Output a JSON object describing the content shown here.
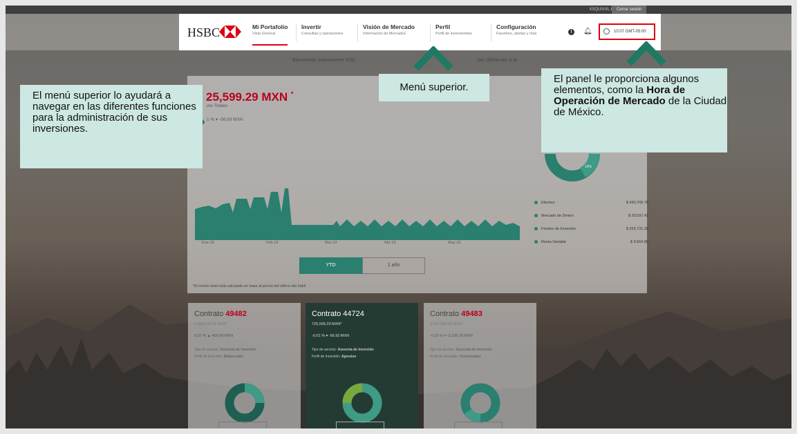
{
  "topbar": {
    "user_info": "XSQUIVXL HILTCN COSTRC",
    "logout": "Cerrar sesión"
  },
  "header": {
    "logo": "HSBC",
    "nav": [
      {
        "title": "Mi Portafolio",
        "subtitle": "Vista General"
      },
      {
        "title": "Invertir",
        "subtitle": "Consultas y operaciones"
      },
      {
        "title": "Visión de Mercado",
        "subtitle": "Información de Mercados"
      },
      {
        "title": "Perfil",
        "subtitle": "Perfil de inversionista"
      },
      {
        "title": "Configuración",
        "subtitle": "Favoritos, alertas y más"
      }
    ],
    "clock": "10:07 GMT-05:00"
  },
  "welcome": {
    "left": "Bienvenido nuevamente XSC",
    "right": "por última vez a la"
  },
  "summary": {
    "balance": "25,599.29 MXN",
    "balance_mark": "*",
    "label": "vos Totales",
    "change": "1 %  ▾  -56.93 MXN",
    "months": [
      "Ene-19",
      "Feb-19",
      "Mar-19",
      "Abr-19",
      "May-19"
    ],
    "btn_ytd": "YTD",
    "btn_1y": "1 año",
    "footnote": "*El monto total está calculado en base al precio del último día hábil"
  },
  "allocation": {
    "center_pct": "10%",
    "legend": [
      {
        "label": "Efectivo",
        "value": "$ 430,709.78"
      },
      {
        "label": "Mercado de Dinero",
        "value": "$ 29,597.43"
      },
      {
        "label": "Fondos de Inversión",
        "value": "$ 255,731.28"
      },
      {
        "label": "Renta Variable",
        "value": "$ 9,564.80"
      }
    ]
  },
  "contracts": [
    {
      "title": "Contrato",
      "number": "49482",
      "amount": "1,000,539.29 MXN*",
      "change": "0.07 %  ▲  490.00 MXN",
      "service_label": "Tipo de servicio:",
      "service": "Asesoría de Inversión",
      "profile_label": "Perfil de Inversión:",
      "profile": "Balanceado"
    },
    {
      "title": "Contrato",
      "number": "44724",
      "amount": "725,599.29 MXN*",
      "change": "-0.01 %  ▾  -56.93 MXN",
      "service_label": "Tipo de servicio:",
      "service": "Asesoría de Inversión",
      "profile_label": "Perfil de Inversión:",
      "profile": "Agresivo"
    },
    {
      "title": "Contrato",
      "number": "49483",
      "amount": "3,203,083.93 MXN*",
      "change": "-0.10 %  ▾  -3,338.30 MXN",
      "service_label": "Tipo de servicio:",
      "service": "Asesoría de Inversión",
      "profile_label": "Perfil de Inversión:",
      "profile": "Conservador"
    }
  ],
  "callouts": {
    "left": "El menú superior lo ayudará a navegar en las diferentes funciones para la administración de sus inversiones.",
    "mid": "Menú superior.",
    "right_1": "El panel le proporciona algunos elementos, como la ",
    "right_bold": "Hora de Operación de Mercado",
    "right_2": " de la Ciudad de México."
  },
  "colors": {
    "accent_red": "#db0011",
    "teal": "#2a7f6e",
    "callout_bg": "#cde7e2"
  }
}
